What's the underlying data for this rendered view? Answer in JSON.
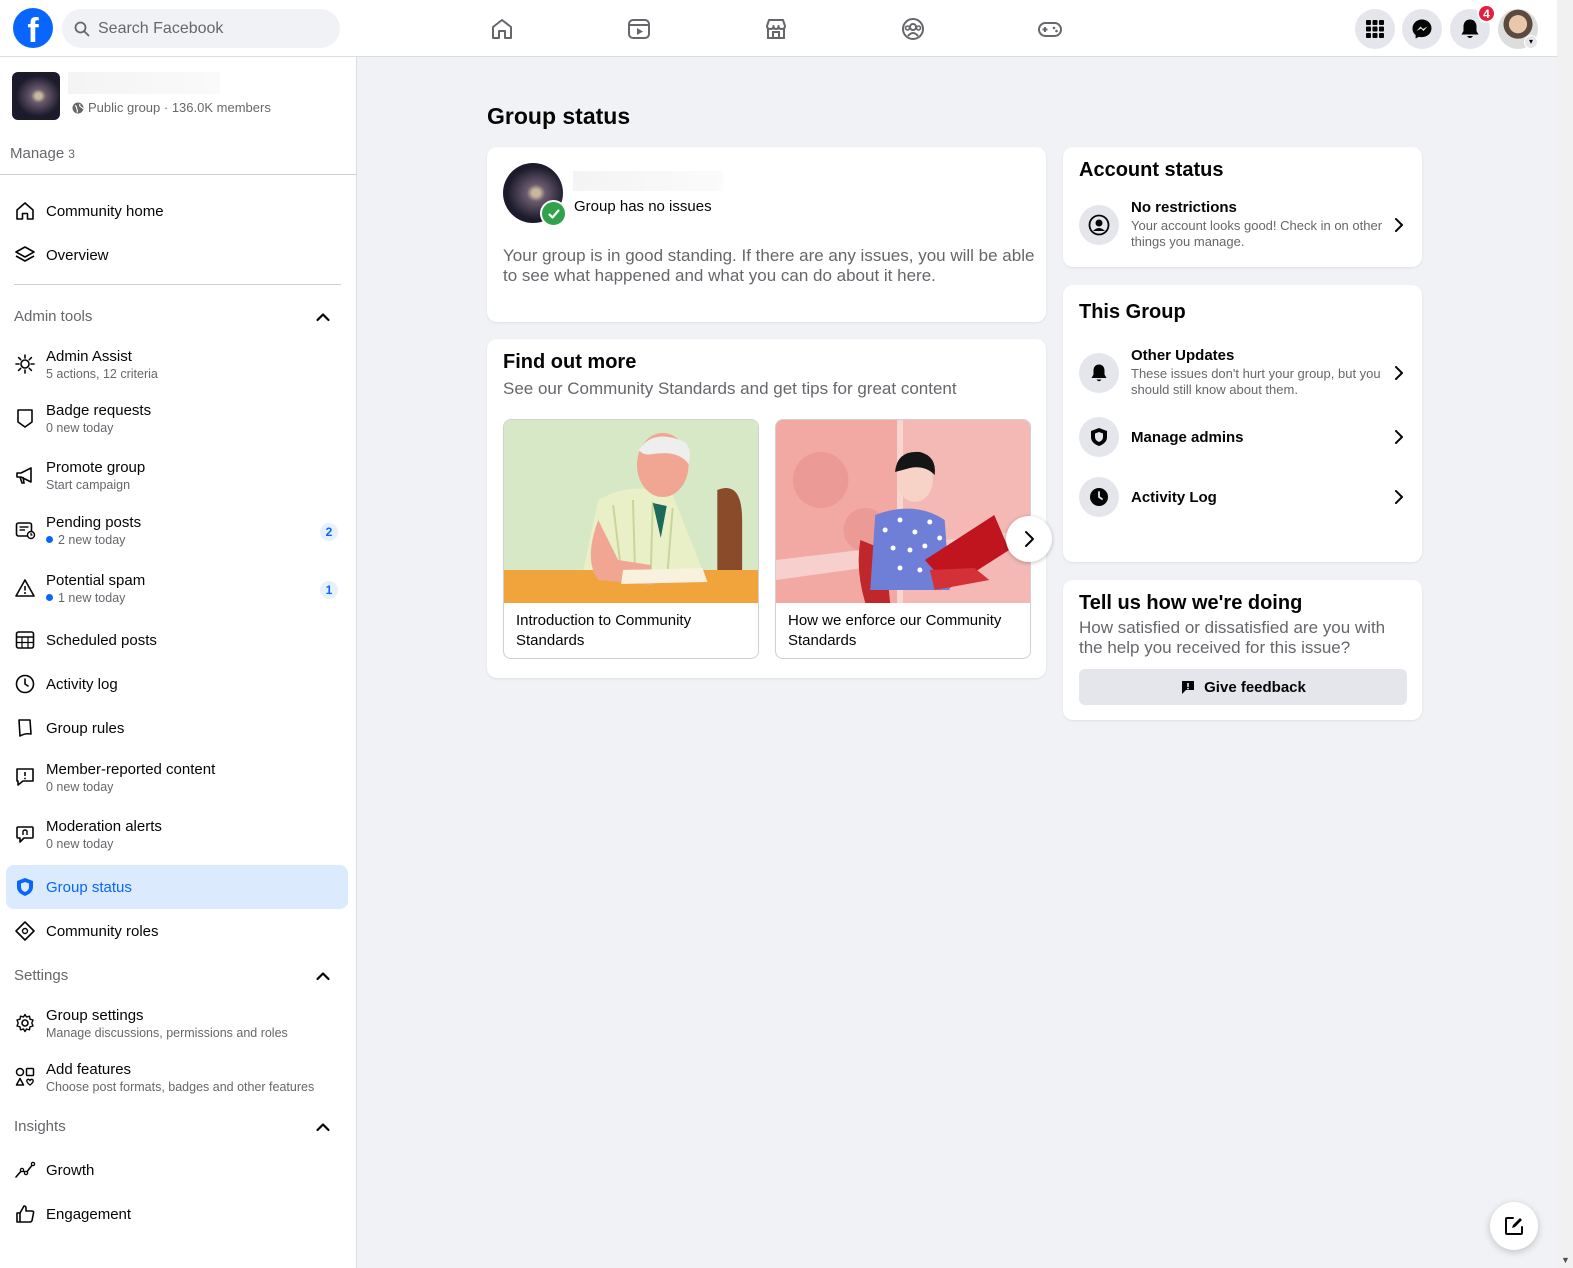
{
  "topbar": {
    "logo": "f",
    "search_placeholder": "Search Facebook",
    "nav_icons": [
      "home-icon",
      "video-icon",
      "marketplace-icon",
      "groups-icon",
      "gaming-icon"
    ],
    "notification_count": "4"
  },
  "sidebar": {
    "group_meta": "Public group · 136.0K members",
    "manage_label": "Manage",
    "manage_count": "3",
    "top_items": [
      {
        "label": "Community home"
      },
      {
        "label": "Overview"
      }
    ],
    "admin_tools_title": "Admin tools",
    "admin_items": [
      {
        "label": "Admin Assist",
        "sub": "5 actions, 12 criteria"
      },
      {
        "label": "Badge requests",
        "sub": "0 new today"
      },
      {
        "label": "Promote group",
        "sub": "Start campaign"
      },
      {
        "label": "Pending posts",
        "sub": "2 new today",
        "count": "2"
      },
      {
        "label": "Potential spam",
        "sub": "1 new today",
        "count": "1"
      },
      {
        "label": "Scheduled posts"
      },
      {
        "label": "Activity log"
      },
      {
        "label": "Group rules"
      },
      {
        "label": "Member-reported content",
        "sub": "0 new today"
      },
      {
        "label": "Moderation alerts",
        "sub": "0 new today"
      },
      {
        "label": "Group status"
      },
      {
        "label": "Community roles"
      }
    ],
    "settings_title": "Settings",
    "settings_items": [
      {
        "label": "Group settings",
        "sub": "Manage discussions, permissions and roles"
      },
      {
        "label": "Add features",
        "sub": "Choose post formats, badges and other features"
      }
    ],
    "insights_title": "Insights",
    "insights_items": [
      {
        "label": "Growth"
      },
      {
        "label": "Engagement"
      }
    ]
  },
  "main": {
    "title": "Group status",
    "status_card": {
      "status": "Group has no issues",
      "description": "Your group is in good standing. If there are any issues, you will be able to see what happened and what you can do about it here."
    },
    "find_out_more": {
      "title": "Find out more",
      "subtitle": "See our Community Standards and get tips for great content",
      "tiles": [
        {
          "caption": "Introduction to Community Standards"
        },
        {
          "caption": "How we enforce our Community Standards"
        }
      ]
    }
  },
  "right": {
    "account_status": {
      "title": "Account status",
      "item_label": "No restrictions",
      "item_sub": "Your account looks good! Check in on other things you manage."
    },
    "this_group": {
      "title": "This Group",
      "items": [
        {
          "label": "Other Updates",
          "sub": "These issues don't hurt your group, but you should still know about them."
        },
        {
          "label": "Manage admins"
        },
        {
          "label": "Activity Log"
        }
      ]
    },
    "feedback": {
      "title": "Tell us how we're doing",
      "question": "How satisfied or dissatisfied are you with the help you received for this issue?",
      "button": "Give feedback"
    }
  },
  "colors": {
    "brand": "#0866ff",
    "active_bg": "#dbeafc",
    "success": "#31a24c",
    "badge": "#e41e3f"
  }
}
